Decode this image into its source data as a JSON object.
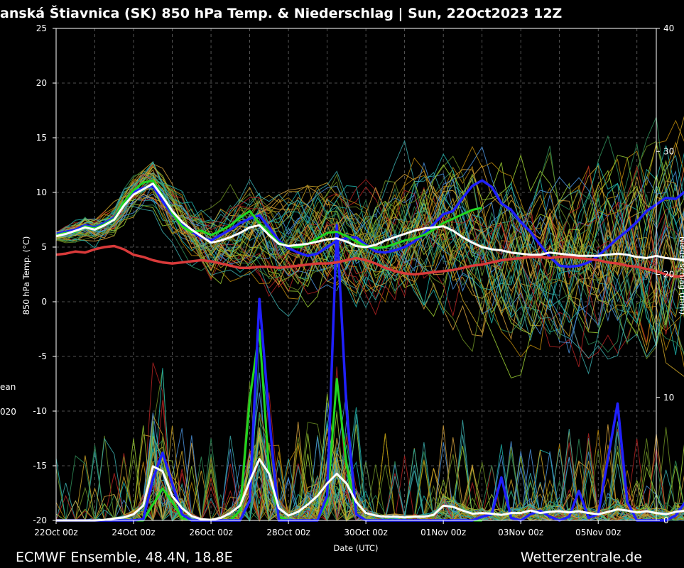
{
  "page": {
    "title": "anská Štiavnica  (SK)  850 hPa Temp. & Niederschlag | Sun, 22Oct2023 12Z",
    "footer_left": "ECMWF Ensemble, 48.4N, 18.8E",
    "footer_right": "Wetterzentrale.de",
    "legend_fragments": [
      "ean",
      "020"
    ]
  },
  "colors": {
    "background": "#000000",
    "grid": "#6a6a6a",
    "mean_temp": "#ffffff",
    "climatology": "#d93a3a",
    "control_run": "#2020ff",
    "operational_run": "#20d820",
    "member_palette": [
      "#c9a227",
      "#b8860b",
      "#3aa8a8",
      "#2e8b57",
      "#4a90d9",
      "#9acd32",
      "#b22222",
      "#d2a03c",
      "#20b2aa",
      "#6b8e23"
    ]
  },
  "chart_data": {
    "type": "line",
    "title": "anská Štiavnica  (SK)  850 hPa Temp. & Niederschlag | Sun, 22Oct2023 12Z",
    "xlabel": "Date (UTC)",
    "ylabel": "850 hPa Temp. (°C)",
    "y2label": "Niederschlag (mm)",
    "ylim": [
      -20,
      25
    ],
    "y2lim": [
      0,
      40
    ],
    "yticks": [
      "25",
      "20",
      "15",
      "10",
      "5",
      "0",
      "-5",
      "-10",
      "-15",
      "-20"
    ],
    "y2ticks": [
      "40",
      "30",
      "20",
      "10",
      "0"
    ],
    "xlim": [
      0,
      15.5
    ],
    "xticks": [
      {
        "x": 0,
        "label": "22Oct 00z"
      },
      {
        "x": 2,
        "label": "24Oct 00z"
      },
      {
        "x": 4,
        "label": "26Oct 00z"
      },
      {
        "x": 6,
        "label": "28Oct 00z"
      },
      {
        "x": 8,
        "label": "30Oct 00z"
      },
      {
        "x": 10,
        "label": "01Nov 00z"
      },
      {
        "x": 12,
        "label": "03Nov 00z"
      },
      {
        "x": 14,
        "label": "05Nov 00z"
      }
    ],
    "grid": true,
    "step_days": 0.25,
    "members": 50,
    "series": [
      {
        "role": "ensemble mean 850 hPa temperature",
        "values": [
          6.0,
          6.2,
          6.5,
          6.8,
          6.6,
          7.0,
          7.5,
          8.8,
          9.8,
          10.3,
          10.8,
          9.6,
          8.3,
          7.3,
          6.6,
          6.0,
          5.4,
          5.6,
          5.9,
          6.3,
          6.8,
          7.0,
          6.1,
          5.3,
          5.1,
          5.2,
          5.3,
          5.5,
          5.7,
          5.8,
          5.5,
          5.1,
          5.0,
          5.2,
          5.6,
          5.9,
          6.2,
          6.5,
          6.7,
          6.8,
          6.9,
          6.5,
          5.9,
          5.4,
          5.0,
          4.8,
          4.7,
          4.5,
          4.4,
          4.3,
          4.3,
          4.5,
          4.4,
          4.3,
          4.2,
          4.2,
          4.2,
          4.3,
          4.4,
          4.3,
          4.1,
          4.0,
          4.2,
          4.0,
          3.9,
          3.8
        ]
      },
      {
        "role": "climatology 850 hPa temperature",
        "values": [
          4.3,
          4.4,
          4.6,
          4.5,
          4.8,
          5.0,
          5.1,
          4.8,
          4.3,
          4.1,
          3.8,
          3.6,
          3.5,
          3.6,
          3.7,
          3.8,
          3.7,
          3.5,
          3.3,
          3.1,
          3.1,
          3.2,
          3.2,
          3.1,
          3.2,
          3.3,
          3.4,
          3.5,
          3.5,
          3.6,
          3.8,
          4.0,
          3.8,
          3.5,
          3.1,
          2.8,
          2.6,
          2.5,
          2.6,
          2.7,
          2.8,
          2.9,
          3.1,
          3.3,
          3.4,
          3.6,
          3.8,
          3.9,
          4.0,
          4.1,
          4.1,
          4.0,
          4.1,
          4.1,
          4.0,
          3.9,
          3.8,
          3.6,
          3.5,
          3.3,
          3.2,
          3.0,
          2.8,
          2.5,
          2.3,
          2.4
        ]
      },
      {
        "role": "control run 850 hPa temperature",
        "values": [
          6.2,
          6.4,
          6.6,
          7.0,
          6.8,
          7.2,
          7.7,
          9.0,
          10.0,
          10.4,
          10.6,
          9.2,
          8.0,
          7.1,
          6.4,
          5.9,
          5.6,
          6.1,
          6.6,
          7.2,
          7.6,
          7.9,
          6.8,
          5.6,
          4.9,
          4.5,
          4.2,
          4.4,
          5.0,
          5.6,
          5.8,
          5.9,
          5.2,
          4.6,
          4.5,
          4.7,
          5.0,
          5.5,
          6.2,
          7.1,
          8.0,
          8.3,
          9.5,
          10.6,
          11.1,
          10.5,
          9.0,
          8.4,
          7.3,
          6.4,
          5.2,
          4.1,
          3.3,
          3.2,
          3.3,
          3.6,
          4.2,
          5.0,
          5.8,
          6.5,
          7.3,
          8.3,
          8.9,
          9.5,
          9.4,
          10.1
        ]
      },
      {
        "role": "operational run 850 hPa temperature",
        "values": [
          6.1,
          6.3,
          6.4,
          6.9,
          6.7,
          7.1,
          7.6,
          9.1,
          10.2,
          10.9,
          11.1,
          9.7,
          8.1,
          6.9,
          6.4,
          6.5,
          6.1,
          6.5,
          7.0,
          7.7,
          8.3,
          7.2,
          6.3,
          5.4,
          5.1,
          5.0,
          5.3,
          5.8,
          6.3,
          6.4,
          6.0,
          5.5,
          5.1,
          4.9,
          5.0,
          5.3,
          5.6,
          5.8,
          6.1,
          6.6,
          7.2,
          7.6,
          8.0,
          8.4,
          8.6
        ]
      },
      {
        "role": "ensemble mean precipitation",
        "values": [
          0,
          0,
          0,
          0,
          0,
          0.05,
          0.15,
          0.25,
          0.5,
          1.2,
          4.4,
          4.0,
          2.0,
          1.0,
          0.35,
          0.1,
          0.05,
          0.2,
          0.6,
          1.2,
          3.2,
          5.0,
          3.8,
          1.0,
          0.4,
          0.7,
          1.3,
          2.0,
          3.0,
          3.8,
          3.0,
          1.5,
          0.6,
          0.4,
          0.3,
          0.3,
          0.25,
          0.3,
          0.3,
          0.45,
          1.2,
          1.1,
          0.8,
          0.55,
          0.6,
          0.55,
          0.45,
          0.6,
          0.6,
          0.8,
          0.6,
          0.7,
          0.75,
          0.65,
          0.75,
          0.6,
          0.5,
          0.7,
          0.9,
          0.8,
          0.65,
          0.75,
          0.6,
          0.5,
          0.7,
          0.8
        ]
      },
      {
        "role": "control run precipitation",
        "values": [
          0,
          0,
          0,
          0,
          0,
          0,
          0,
          0,
          0,
          0.1,
          3.4,
          5.5,
          3.0,
          0.5,
          0,
          0,
          0,
          0,
          0,
          0,
          1.6,
          18.0,
          8.5,
          0,
          0,
          0,
          0,
          0,
          2.0,
          24.0,
          9.0,
          0.5,
          0,
          0,
          0,
          0,
          0,
          0,
          0,
          0,
          0,
          0,
          0,
          0,
          0.3,
          0.5,
          3.5,
          0.2,
          0,
          0.5,
          0.8,
          0.3,
          0,
          0.3,
          2.4,
          0.2,
          0.5,
          5.0,
          9.5,
          1.5,
          0,
          0,
          0,
          0,
          0.4,
          1.5
        ]
      },
      {
        "role": "operational run precipitation",
        "values": [
          0,
          0,
          0,
          0,
          0,
          0,
          0,
          0,
          0,
          0,
          1.3,
          2.6,
          1.5,
          0.2,
          0,
          0,
          0,
          0,
          0,
          0.8,
          9.8,
          15.5,
          4.0,
          0.3,
          0,
          0,
          0,
          0,
          1.5,
          11.5,
          4.5,
          0.5,
          0,
          0,
          0,
          0,
          0,
          0,
          0,
          0,
          0,
          0,
          0,
          0,
          0
        ]
      }
    ]
  }
}
